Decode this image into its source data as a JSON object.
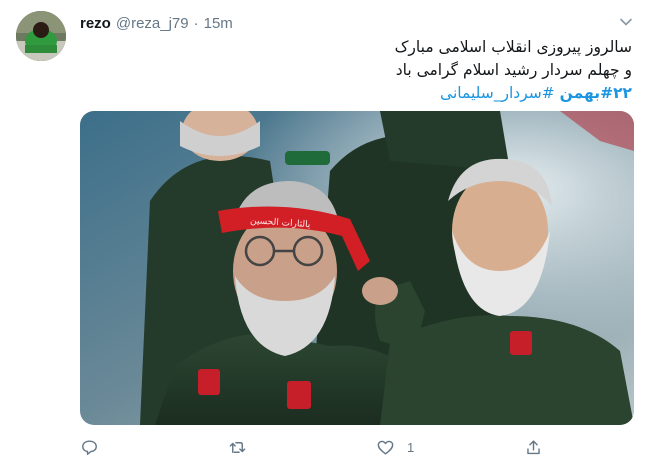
{
  "tweet": {
    "author": {
      "display_name": "rezo",
      "handle": "@reza_j79",
      "separator": "·",
      "time": "15m"
    },
    "text": {
      "line1": "سالروز پیروزی انقلاب اسلامی مبارک",
      "line2": "و چهلم سردار رشید اسلام گرامی باد"
    },
    "hashtags": [
      "#۲۲بهمن",
      "#سردار_سلیمانی"
    ],
    "media": {
      "banner_text": "یالثارات الحسین"
    },
    "actions": {
      "reply_count": "",
      "retweet_count": "",
      "like_count": "1"
    },
    "colors": {
      "link": "#1b95e0",
      "secondary_text": "#657786",
      "icon": "#657786"
    },
    "icons": {
      "menu": "chevron-down-icon",
      "reply": "reply-icon",
      "retweet": "retweet-icon",
      "like": "heart-icon",
      "share": "share-icon"
    }
  }
}
